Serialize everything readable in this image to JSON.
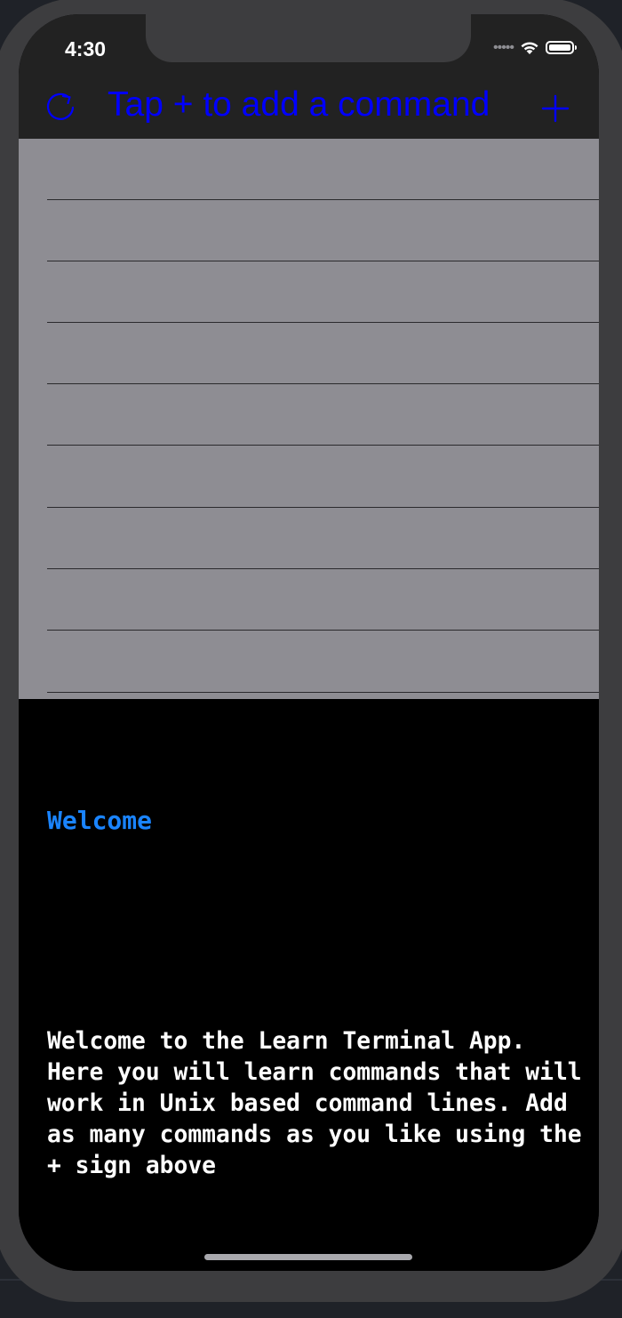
{
  "status_bar": {
    "time": "4:30",
    "signal_dots": "•••••"
  },
  "nav": {
    "title": "Tap + to add a command",
    "refresh_icon": "refresh-icon",
    "add_icon": "plus-icon"
  },
  "list": {
    "rows": [
      "",
      "",
      "",
      "",
      "",
      "",
      "",
      "",
      ""
    ]
  },
  "detail": {
    "title": "Welcome",
    "body": "Welcome to the Learn Terminal App. Here you will learn commands that will work in Unix based command lines. Add as many commands as you like using the + sign above"
  },
  "colors": {
    "accent_blue": "#0000ff",
    "title_blue": "#1a84ff",
    "list_background": "#8e8d93",
    "nav_background": "#222222"
  }
}
